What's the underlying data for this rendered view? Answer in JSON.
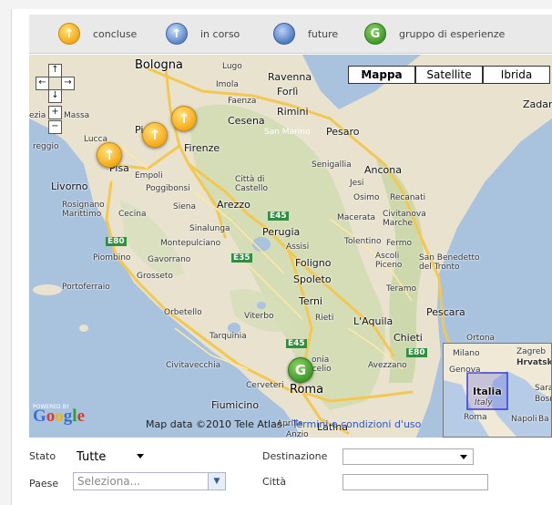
{
  "legend": {
    "items": [
      {
        "label": "concluse",
        "icon": "arrow-up-orange-icon",
        "color": "#f5a91a",
        "glyph": "↑"
      },
      {
        "label": "in corso",
        "icon": "arrow-up-blue-icon",
        "color": "#5b86c9",
        "glyph": "↑"
      },
      {
        "label": "future",
        "icon": "blue-dot-icon",
        "color": "#4f7bc4",
        "glyph": ""
      },
      {
        "label": "gruppo di esperienze",
        "icon": "group-g-icon",
        "color": "#3f9a2a",
        "glyph": "G"
      }
    ]
  },
  "map": {
    "types": [
      "Mappa",
      "Satellite",
      "Ibrida"
    ],
    "active_type": "Mappa",
    "nav": {
      "up": "↑",
      "left": "←",
      "right": "→",
      "down": "↓",
      "zoom_in": "+",
      "zoom_out": "−"
    },
    "cities": {
      "bologna": "Bologna",
      "lugo": "Lugo",
      "ravenna": "Ravenna",
      "imola": "Imola",
      "forli": "Forlì",
      "faenza": "Faenza",
      "rimini": "Rimini",
      "cesena": "Cesena",
      "san_marino": "San Marino",
      "pesaro": "Pesaro",
      "zadar": "Zadar",
      "spezia": "ezia",
      "massa": "Massa",
      "lucca": "Lucca",
      "pi": "Pi",
      "viareggio": "reggio",
      "firenze": "Firenze",
      "pisa": "Pisa",
      "empoli": "Empoli",
      "senigallia": "Senigallia",
      "ancona": "Ancona",
      "jesi": "Jesi",
      "livorno": "Livorno",
      "poggibonsi": "Poggibonsi",
      "citta_di_castello": "Città di\nCastello",
      "osimo": "Osimo",
      "recanati": "Recanati",
      "rosignano": "Rosignano\nMarittimo",
      "cecina": "Cecina",
      "siena": "Siena",
      "arezzo": "Arezzo",
      "macerata": "Macerata",
      "civitanova": "Civitanova\nMarche",
      "sinalunga": "Sinalunga",
      "perugia": "Perugia",
      "tolentino": "Tolentino",
      "montepulciano": "Montepulciano",
      "assisi": "Assisi",
      "fermo": "Fermo",
      "piombino": "Piombino",
      "gavorrano": "Gavorrano",
      "foligno": "Foligno",
      "ascoli": "Ascoli\nPiceno",
      "san_benedetto": "San Benedetto\ndel Tronto",
      "grosseto": "Grosseto",
      "spoleto": "Spoleto",
      "portoferraio": "Portoferraio",
      "teramo": "Teramo",
      "terni": "Terni",
      "orbetello": "Orbetello",
      "viterbo": "Viterbo",
      "rieti": "Rieti",
      "laquila": "L'Aquila",
      "pescara": "Pescara",
      "chieti": "Chieti",
      "ortona": "Ortona",
      "tarquinia": "Tarquinia",
      "civitavecchia": "Civitavecchia",
      "avezzano": "Avezzano",
      "cerveteri": "Cerveteri",
      "roma": "Roma",
      "fiumicino": "Fiumicino",
      "aprilia": "Aprilia",
      "latina": "Latina",
      "anzio": "Anzio",
      "tivoli_frag": "onia",
      "frascati_frag": "scelio"
    },
    "roads": {
      "e45a": "E45",
      "e80a": "E80",
      "e35": "E35",
      "e45b": "E45",
      "e80b": "E80"
    },
    "markers": [
      {
        "kind": "concluse",
        "glyph": "↑"
      },
      {
        "kind": "concluse",
        "glyph": "↑"
      },
      {
        "kind": "concluse",
        "glyph": "↑"
      },
      {
        "kind": "gruppo",
        "glyph": "G"
      }
    ],
    "attribution": "Map data ©2010 Tele Atlas -",
    "terms_link": "Termini e condizioni d'uso",
    "powered_by": "POWERED BY",
    "google_letters": [
      "G",
      "o",
      "o",
      "g",
      "l",
      "e"
    ],
    "google_colors": [
      "#3a6fd8",
      "#d8392a",
      "#f0b400",
      "#3a6fd8",
      "#2f9a3a",
      "#d8392a"
    ],
    "overview": {
      "milano": "Milano",
      "zagreb": "Zagreb",
      "hrvatska": "Hrvatska",
      "genova": "Genova",
      "italia": "Italia",
      "italy": "Italy",
      "roma": "Roma",
      "napoli": "Napoli",
      "sarajevo_frag": "Saraje",
      "bosnia_frag": "Bosne",
      "ba_frag": "Ba"
    }
  },
  "form": {
    "stato_label": "Stato",
    "stato_value": "Tutte",
    "destinazione_label": "Destinazione",
    "destinazione_value": "",
    "paese_label": "Paese",
    "paese_placeholder": "Seleziona...",
    "citta_label": "Città",
    "citta_value": ""
  }
}
